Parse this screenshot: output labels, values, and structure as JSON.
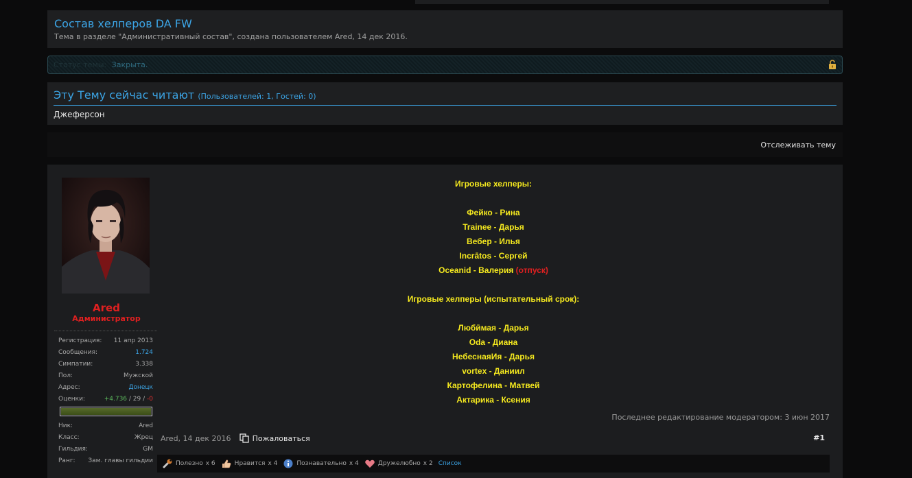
{
  "topnav": [],
  "thread": {
    "title": "Состав хелперов DA FW",
    "subtitle": "Тема в разделе \"Административный состав\", создана пользователем Ared, 14 дек 2016."
  },
  "status": {
    "label": "Статус темы:",
    "value": "Закрыта."
  },
  "readers": {
    "title": "Эту Тему сейчас читают",
    "counts": "(Пользователей: 1, Гостей: 0)",
    "names": "Джеферсон"
  },
  "toolbar": {
    "watch_label": "Отслеживать тему"
  },
  "author": {
    "name": "Ared",
    "role": "Администратор",
    "stats": [
      {
        "key": "Регистрация:",
        "value": "11 апр 2013"
      },
      {
        "key": "Сообщения:",
        "value": "1.724"
      },
      {
        "key": "Симпатии:",
        "value": "3.338"
      },
      {
        "key": "Пол:",
        "value": "Мужской"
      },
      {
        "key": "Адрес:",
        "value": "Донецк"
      }
    ],
    "ratings": {
      "key": "Оценки:",
      "positive": "+4.736",
      "neutral": "29",
      "negative": "-0"
    },
    "extra": [
      {
        "key": "Ник:",
        "value": "Ared"
      },
      {
        "key": "Класс:",
        "value": "Жрец"
      },
      {
        "key": "Гильдия:",
        "value": "GM"
      },
      {
        "key": "Ранг:",
        "value": "Зам. главы гильдии"
      }
    ]
  },
  "post": {
    "heading1": "Игровые хелперы:",
    "helpers": [
      "Фейко - Рина",
      "Trainee - Дарья",
      "Вебер - Илья",
      "Incrātos - Сергей",
      "Oceanid - Валерия"
    ],
    "vacation": "(отпуск)",
    "heading2": "Игровые хелперы (испытательный срок):",
    "trainees": [
      "Любӣмая - Дарья",
      "Oda - Диана",
      "НебеснаяИя - Дарья",
      "vortex - Даниил",
      "Картофелина - Матвей",
      "Актарика - Ксения"
    ],
    "edited": "Последнее редактирование модератором: 3 июн 2017",
    "date": "Ared, 14 дек 2016",
    "report": "Пожаловаться",
    "number": "#1"
  },
  "reactions": [
    {
      "label": "Полезно",
      "count": "x 6"
    },
    {
      "label": "Нравится",
      "count": "x 4"
    },
    {
      "label": "Познавательно",
      "count": "x 4"
    },
    {
      "label": "Дружелюбно",
      "count": "x 2"
    }
  ],
  "reactions_list": "Список",
  "colors": {
    "accent": "#3ca5e6",
    "admin": "#e02020",
    "post_text": "#f5e91f"
  }
}
